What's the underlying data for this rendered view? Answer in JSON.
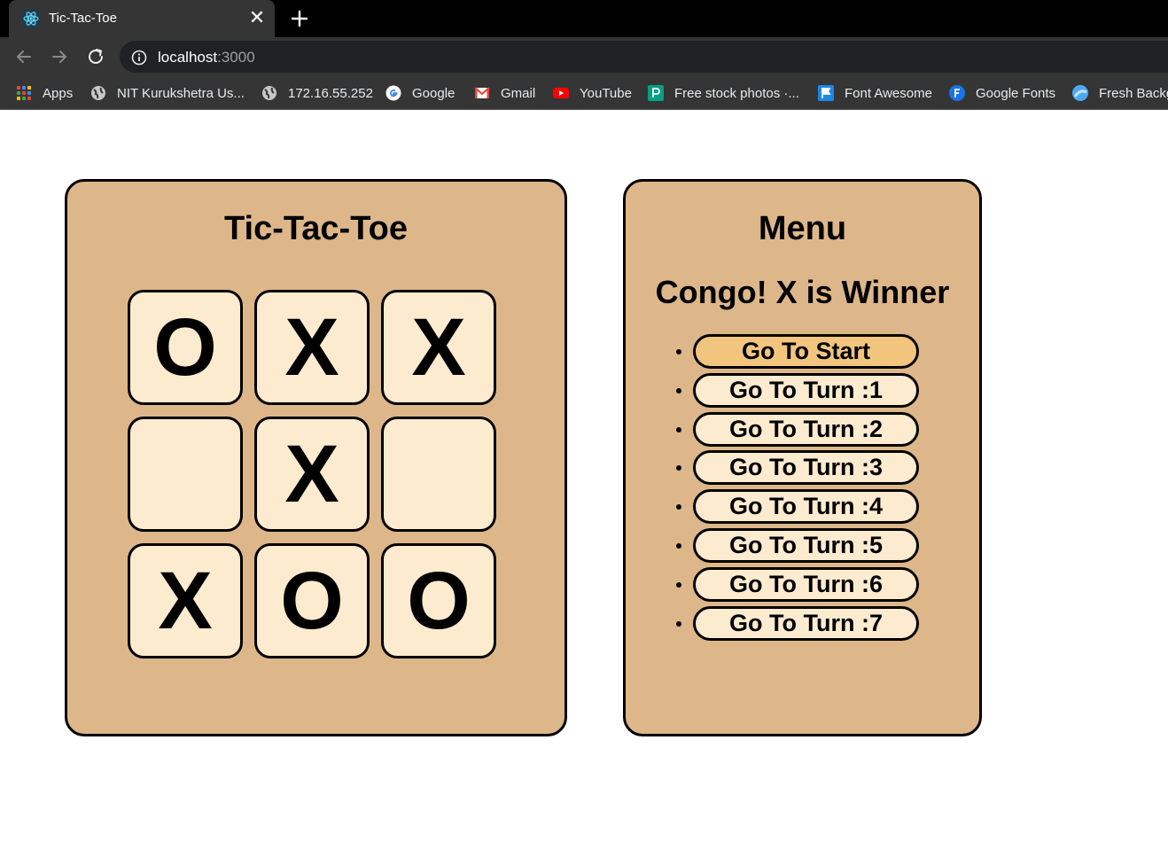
{
  "browser": {
    "tab_title": "Tic-Tac-Toe",
    "tab_close": "✕",
    "url_host": "localhost",
    "url_port": ":3000",
    "bookmarks": [
      {
        "label": "Apps",
        "icon": "apps-grid-icon"
      },
      {
        "label": "NIT Kurukshetra Us...",
        "icon": "globe-icon"
      },
      {
        "label": "172.16.55.252",
        "icon": "globe-icon"
      },
      {
        "label": "Google",
        "icon": "google-icon"
      },
      {
        "label": "Gmail",
        "icon": "gmail-icon"
      },
      {
        "label": "YouTube",
        "icon": "youtube-icon"
      },
      {
        "label": "Free stock photos ·...",
        "icon": "pexels-icon"
      },
      {
        "label": "Font Awesome",
        "icon": "font-awesome-icon"
      },
      {
        "label": "Google Fonts",
        "icon": "google-fonts-icon"
      },
      {
        "label": "Fresh Backg",
        "icon": "fresh-backgrounds-icon"
      }
    ]
  },
  "game": {
    "title": "Tic-Tac-Toe",
    "board": [
      "O",
      "X",
      "X",
      "",
      "X",
      "",
      "X",
      "O",
      "O"
    ]
  },
  "menu": {
    "title": "Menu",
    "status": "Congo! X is Winner",
    "moves": [
      {
        "label": "Go To Start",
        "active": true
      },
      {
        "label": "Go To Turn :1",
        "active": false
      },
      {
        "label": "Go To Turn :2",
        "active": false
      },
      {
        "label": "Go To Turn :3",
        "active": false
      },
      {
        "label": "Go To Turn :4",
        "active": false
      },
      {
        "label": "Go To Turn :5",
        "active": false
      },
      {
        "label": "Go To Turn :6",
        "active": false
      },
      {
        "label": "Go To Turn :7",
        "active": false
      }
    ]
  },
  "colors": {
    "panel": "#ddb78a",
    "cell": "#fdebd0",
    "active_button": "#f2c57f",
    "chrome_dark": "#353535"
  }
}
